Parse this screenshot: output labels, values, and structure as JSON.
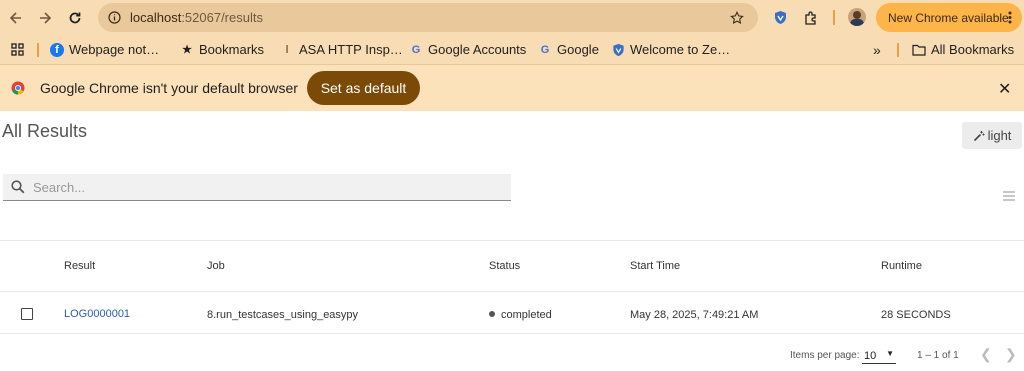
{
  "browser": {
    "url_host": "localhost",
    "url_path": ":52067/results",
    "new_chrome_label": "New Chrome available",
    "bookmarks": [
      {
        "label": "Webpage not…",
        "icon": "facebook-icon"
      },
      {
        "label": "Bookmarks",
        "icon": "star-icon"
      },
      {
        "label": "ASA HTTP Insp…",
        "icon": "asa-icon"
      },
      {
        "label": "Google Accounts",
        "icon": "google-icon"
      },
      {
        "label": "Google",
        "icon": "google-icon"
      },
      {
        "label": "Welcome to Ze…",
        "icon": "shield-icon"
      }
    ],
    "all_bookmarks_label": "All Bookmarks",
    "overflow_label": "»"
  },
  "infobar": {
    "message": "Google Chrome isn't your default browser",
    "set_default_label": "Set as default"
  },
  "page": {
    "title": "All Results",
    "theme_button_label": "light",
    "search_placeholder": "Search..."
  },
  "table": {
    "columns": [
      "Result",
      "Job",
      "Status",
      "Start Time",
      "Runtime"
    ],
    "rows": [
      {
        "result": "LOG0000001",
        "job": "8.run_testcases_using_easypy",
        "status": "completed",
        "start_time": "May 28, 2025, 7:49:21 AM",
        "runtime": "28 SECONDS"
      }
    ]
  },
  "pagination": {
    "items_per_page_label": "Items per page:",
    "items_per_page_value": "10",
    "range_label": "1 – 1 of 1"
  },
  "colors": {
    "accent": "#7a4a06",
    "link": "#2a5db0",
    "chrome_bg": "#f8ddb4"
  }
}
